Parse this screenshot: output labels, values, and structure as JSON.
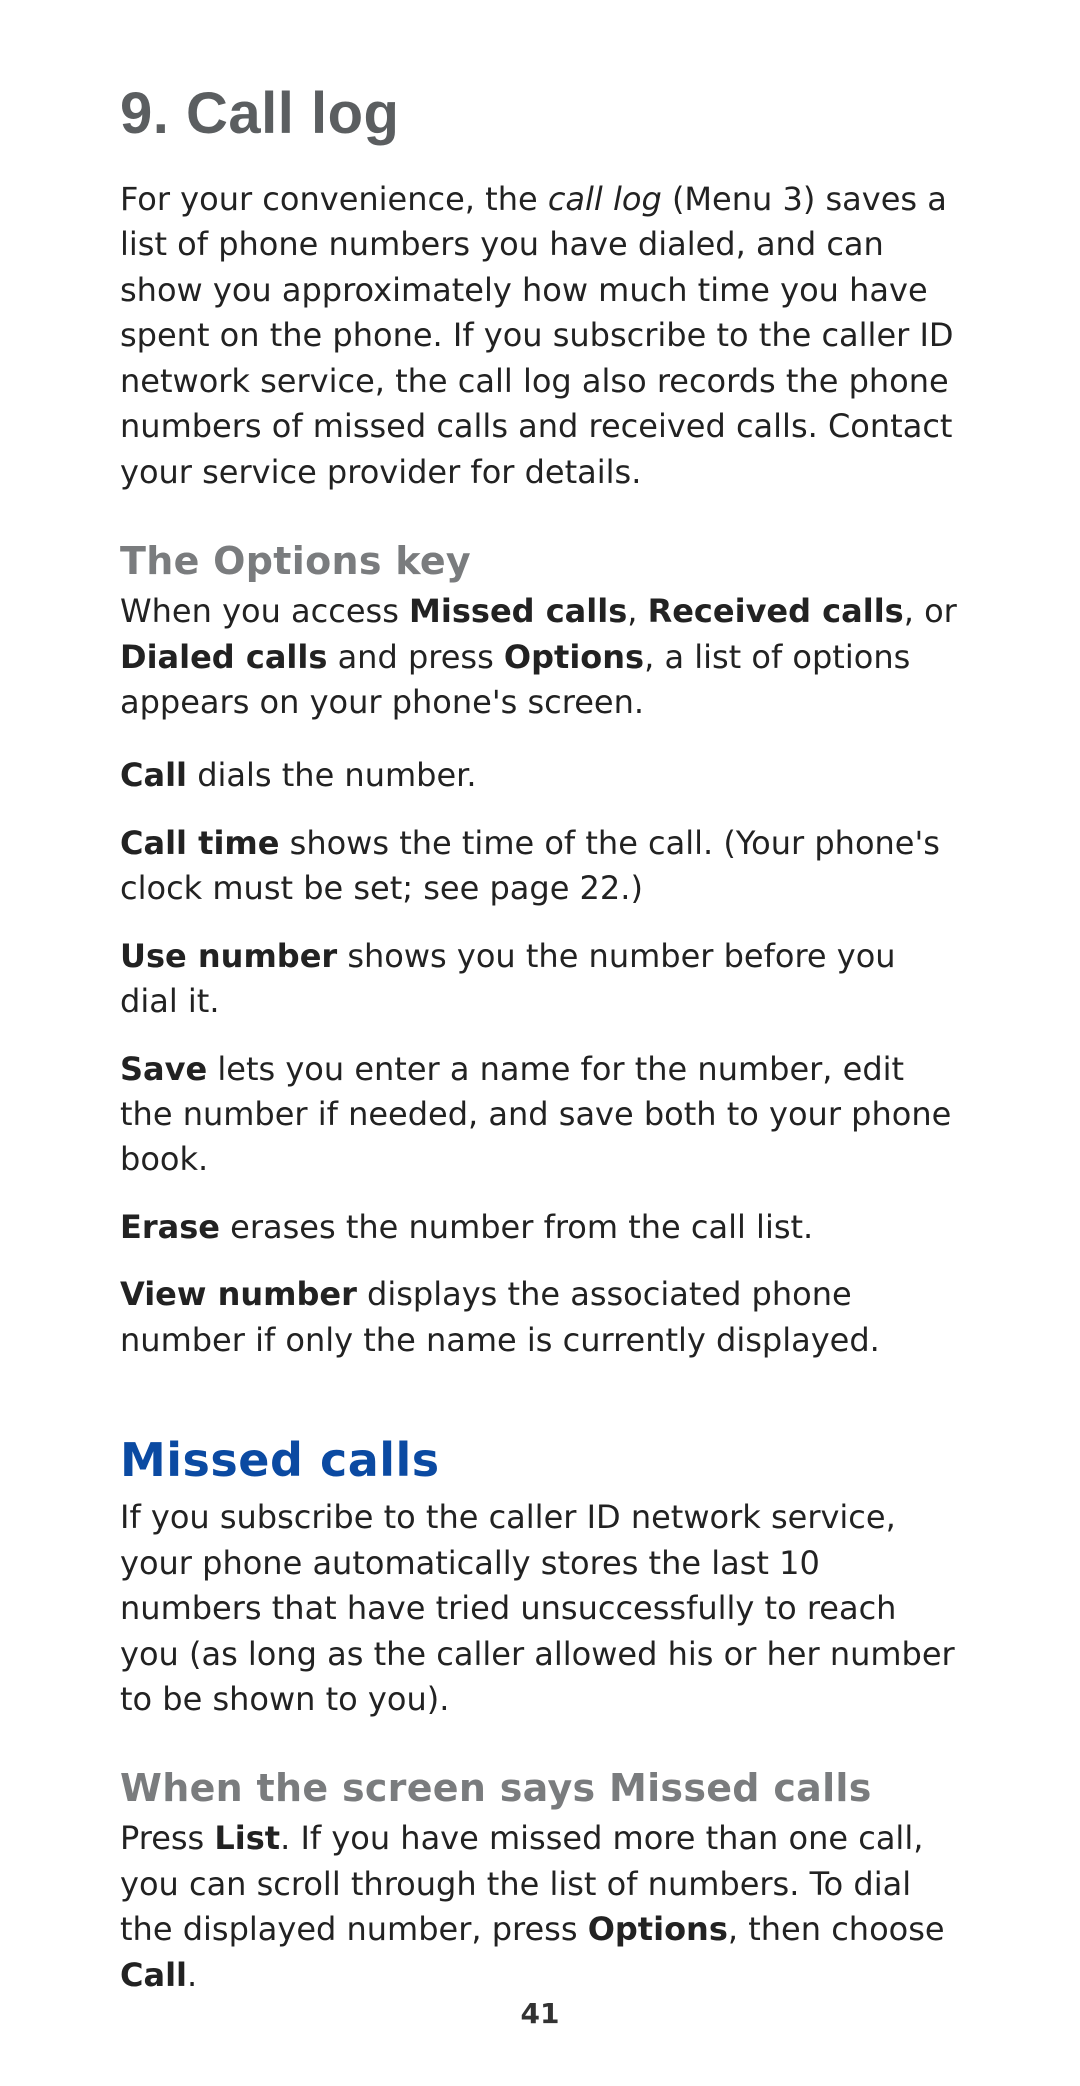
{
  "chapter": {
    "number": "9.",
    "title": "Call log",
    "intro_parts": [
      "For your convenience, the ",
      "call log",
      " (Menu 3) saves a list of phone numbers you have dialed, and can show you approximately how much time you have spent on the phone. If you subscribe to the caller ID network service, the call log also records the phone numbers of missed calls and received calls. Contact your service provider for details."
    ]
  },
  "options_key": {
    "heading": "The Options key",
    "intro": {
      "pre": "When you access ",
      "b1": "Missed calls",
      "sep1": ", ",
      "b2": "Received calls",
      "sep2": ", or ",
      "b3": "Dialed calls",
      "mid": " and press ",
      "b4": "Options",
      "post": ", a list of options appears on your phone's screen."
    },
    "items": [
      {
        "term": "Call",
        "desc": " dials the number."
      },
      {
        "term": "Call time",
        "desc": " shows the time of the call. (Your phone's clock must be set; see page 22.)"
      },
      {
        "term": "Use number",
        "desc": " shows you the number before you dial it."
      },
      {
        "term": "Save",
        "desc": " lets you enter a name for the number, edit the number if needed, and save both to your phone book."
      },
      {
        "term": "Erase",
        "desc": " erases the number from the call list."
      },
      {
        "term": "View number",
        "desc": " displays the associated phone number if only the name is currently displayed."
      }
    ]
  },
  "missed_calls": {
    "heading": "Missed calls",
    "intro": "If you subscribe to the caller ID network service, your phone automatically stores the last 10 numbers that have tried unsuccessfully to reach you (as long as the caller allowed his or her number to be shown to you).",
    "sub_heading": "When the screen says Missed calls",
    "sub_body": {
      "pre": "Press ",
      "b1": "List",
      "mid": ". If you have missed more than one call, you can scroll through the list of numbers. To dial the displayed number, press ",
      "b2": "Options",
      "sep": ", then choose ",
      "b3": "Call",
      "post": "."
    }
  },
  "page_number": "41"
}
